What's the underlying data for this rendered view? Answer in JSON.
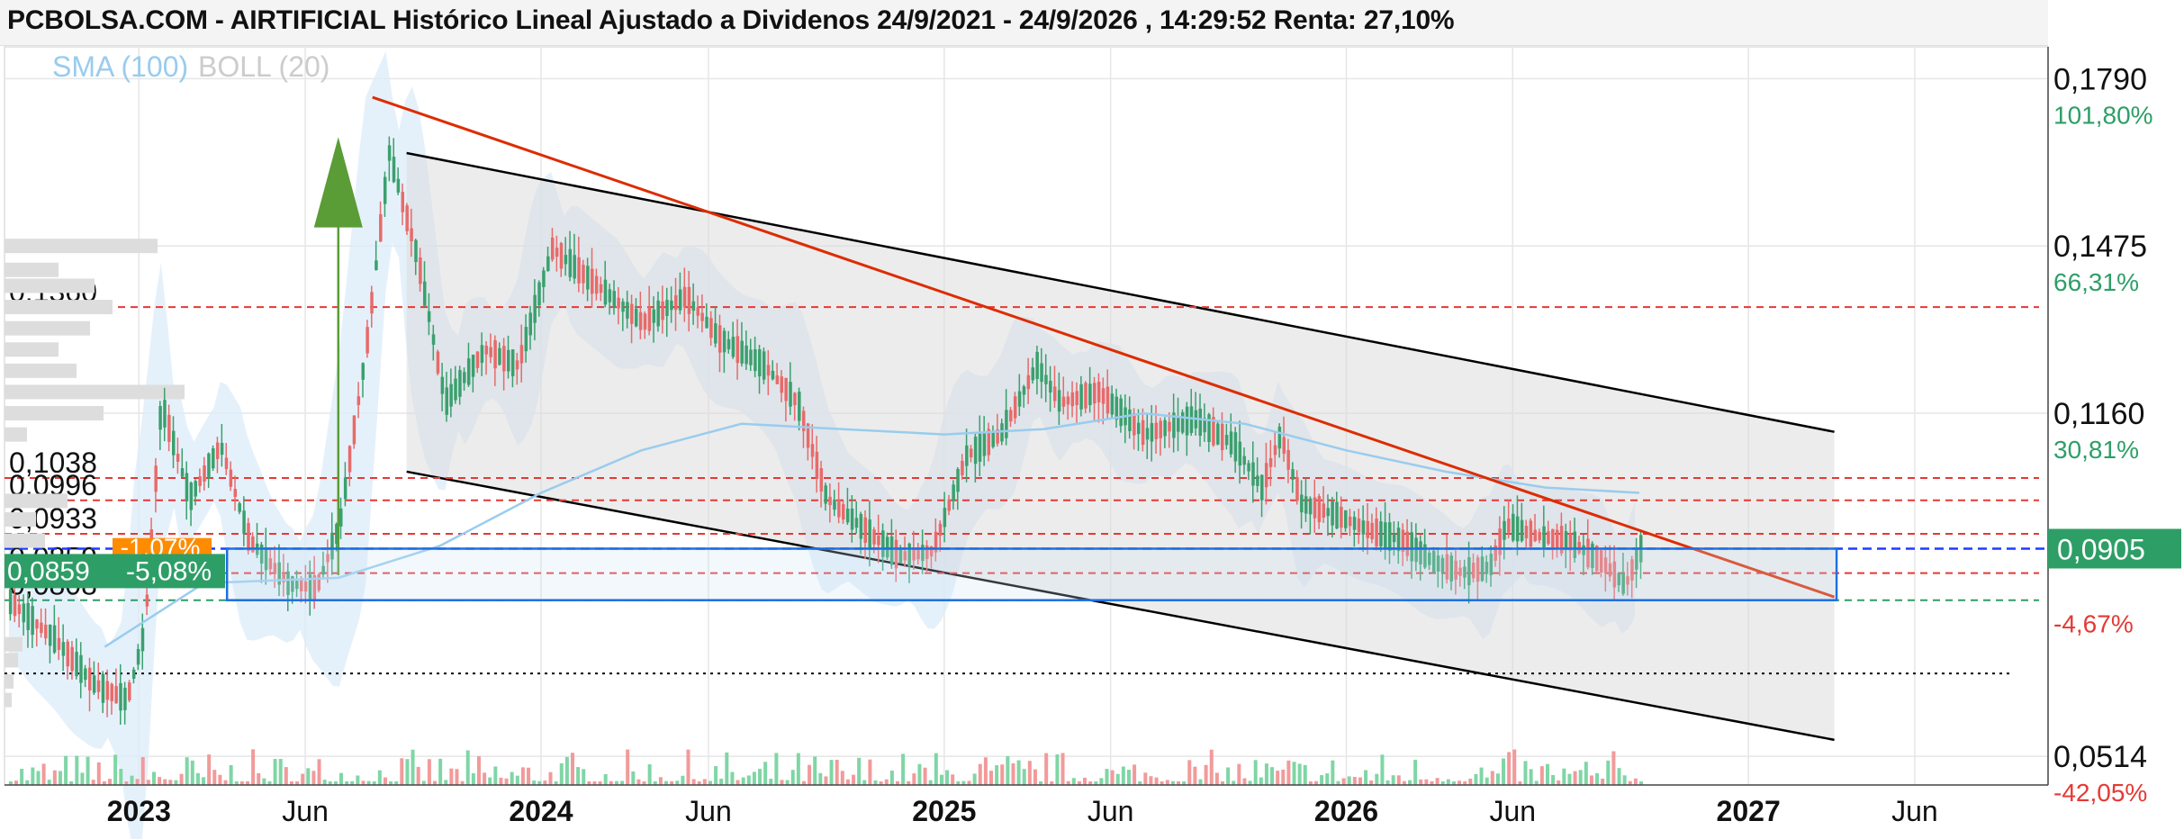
{
  "title": "PCBOLSA.COM - AIRTIFICIAL Histórico Lineal Ajustado a Dividenos 24/9/2021 - 24/9/2026 , 14:29:52 Renta: 27,10%",
  "legend": {
    "sma": "SMA (100)",
    "boll": "BOLL (20)"
  },
  "colors": {
    "up": "#3aa06e",
    "down": "#e86a6a",
    "trend": "#dd2c00",
    "channel": "#000000",
    "sma": "#99ccee",
    "bollFill": "#dcecf8",
    "support": "#e53935",
    "current": "#2e9e67"
  },
  "chart_data": {
    "type": "line",
    "price_axis": {
      "ticks": [
        {
          "value": 0.179,
          "label": "0,1790",
          "pct": "101,80%",
          "pct_color": "#2e9e67"
        },
        {
          "value": 0.1475,
          "label": "0,1475",
          "pct": "66,31%",
          "pct_color": "#2e9e67"
        },
        {
          "value": 0.116,
          "label": "0,1160",
          "pct": "30,81%",
          "pct_color": "#2e9e67"
        },
        {
          "value": 0.0514,
          "label": "0,0514",
          "pct": "-42,05%",
          "pct_color": "#e53935"
        }
      ],
      "current": {
        "value": 0.0905,
        "label": "0,0905"
      },
      "extra_pct": {
        "value": 0.0808,
        "label": "-4,67%"
      },
      "range": [
        0.046,
        0.185
      ]
    },
    "time_axis": {
      "range": [
        "2022-09-01",
        "2027-09-30"
      ],
      "labels": [
        {
          "date": "2023-01-01",
          "label": "2023",
          "bold": true
        },
        {
          "date": "2023-06-01",
          "label": "Jun",
          "bold": false
        },
        {
          "date": "2024-01-01",
          "label": "2024",
          "bold": true
        },
        {
          "date": "2024-06-01",
          "label": "Jun",
          "bold": false
        },
        {
          "date": "2025-01-01",
          "label": "2025",
          "bold": true
        },
        {
          "date": "2025-06-01",
          "label": "Jun",
          "bold": false
        },
        {
          "date": "2026-01-01",
          "label": "2026",
          "bold": true
        },
        {
          "date": "2026-06-01",
          "label": "Jun",
          "bold": false
        },
        {
          "date": "2027-01-01",
          "label": "2027",
          "bold": true
        },
        {
          "date": "2027-06-01",
          "label": "Jun",
          "bold": false
        }
      ]
    },
    "support_levels": [
      {
        "value": 0.136,
        "label": "0,1360"
      },
      {
        "value": 0.1038,
        "label": "0,1038"
      },
      {
        "value": 0.0996,
        "label": "0,0996"
      },
      {
        "value": 0.0933,
        "label": "0,0933"
      },
      {
        "value": 0.0859,
        "label": "0,0859"
      },
      {
        "value": 0.0808,
        "label": "0,0808"
      }
    ],
    "annotations": {
      "left_badge": "-5,08%",
      "left_badge_partial": "-1,07%"
    },
    "price_path": [
      {
        "date": "2022-09-05",
        "value": 0.0805
      },
      {
        "date": "2022-10-15",
        "value": 0.0735
      },
      {
        "date": "2022-11-20",
        "value": 0.065
      },
      {
        "date": "2022-12-20",
        "value": 0.062
      },
      {
        "date": "2023-01-05",
        "value": 0.075
      },
      {
        "date": "2023-01-20",
        "value": 0.118
      },
      {
        "date": "2023-02-15",
        "value": 0.1
      },
      {
        "date": "2023-03-15",
        "value": 0.11
      },
      {
        "date": "2023-04-10",
        "value": 0.092
      },
      {
        "date": "2023-05-15",
        "value": 0.084
      },
      {
        "date": "2023-06-10",
        "value": 0.083
      },
      {
        "date": "2023-07-01",
        "value": 0.095
      },
      {
        "date": "2023-07-25",
        "value": 0.128
      },
      {
        "date": "2023-08-15",
        "value": 0.165
      },
      {
        "date": "2023-09-10",
        "value": 0.145
      },
      {
        "date": "2023-10-05",
        "value": 0.118
      },
      {
        "date": "2023-11-10",
        "value": 0.128
      },
      {
        "date": "2023-12-10",
        "value": 0.125
      },
      {
        "date": "2024-01-10",
        "value": 0.147
      },
      {
        "date": "2024-02-20",
        "value": 0.14
      },
      {
        "date": "2024-04-01",
        "value": 0.133
      },
      {
        "date": "2024-05-10",
        "value": 0.138
      },
      {
        "date": "2024-06-10",
        "value": 0.13
      },
      {
        "date": "2024-07-20",
        "value": 0.125
      },
      {
        "date": "2024-08-20",
        "value": 0.118
      },
      {
        "date": "2024-09-15",
        "value": 0.1
      },
      {
        "date": "2024-10-20",
        "value": 0.094
      },
      {
        "date": "2024-11-20",
        "value": 0.089
      },
      {
        "date": "2024-12-20",
        "value": 0.09
      },
      {
        "date": "2025-01-20",
        "value": 0.108
      },
      {
        "date": "2025-02-20",
        "value": 0.112
      },
      {
        "date": "2025-03-25",
        "value": 0.125
      },
      {
        "date": "2025-04-15",
        "value": 0.118
      },
      {
        "date": "2025-05-20",
        "value": 0.12
      },
      {
        "date": "2025-07-01",
        "value": 0.112
      },
      {
        "date": "2025-08-15",
        "value": 0.115
      },
      {
        "date": "2025-09-20",
        "value": 0.11
      },
      {
        "date": "2025-10-15",
        "value": 0.102
      },
      {
        "date": "2025-11-01",
        "value": 0.112
      },
      {
        "date": "2025-11-20",
        "value": 0.099
      },
      {
        "date": "2025-12-20",
        "value": 0.097
      },
      {
        "date": "2026-01-20",
        "value": 0.094
      },
      {
        "date": "2026-02-20",
        "value": 0.092
      },
      {
        "date": "2026-03-20",
        "value": 0.088
      },
      {
        "date": "2026-04-15",
        "value": 0.086
      },
      {
        "date": "2026-05-10",
        "value": 0.087
      },
      {
        "date": "2026-05-25",
        "value": 0.095
      },
      {
        "date": "2026-06-20",
        "value": 0.093
      },
      {
        "date": "2026-07-20",
        "value": 0.092
      },
      {
        "date": "2026-08-20",
        "value": 0.088
      },
      {
        "date": "2026-09-10",
        "value": 0.0835
      },
      {
        "date": "2026-09-24",
        "value": 0.0905
      }
    ],
    "sma_path": [
      {
        "date": "2022-12-01",
        "value": 0.072
      },
      {
        "date": "2023-03-01",
        "value": 0.084
      },
      {
        "date": "2023-07-01",
        "value": 0.085
      },
      {
        "date": "2023-10-01",
        "value": 0.091
      },
      {
        "date": "2024-01-01",
        "value": 0.101
      },
      {
        "date": "2024-04-01",
        "value": 0.109
      },
      {
        "date": "2024-07-01",
        "value": 0.114
      },
      {
        "date": "2024-10-01",
        "value": 0.113
      },
      {
        "date": "2025-01-01",
        "value": 0.112
      },
      {
        "date": "2025-04-01",
        "value": 0.113
      },
      {
        "date": "2025-07-01",
        "value": 0.116
      },
      {
        "date": "2025-10-01",
        "value": 0.114
      },
      {
        "date": "2026-01-01",
        "value": 0.109
      },
      {
        "date": "2026-04-01",
        "value": 0.105
      },
      {
        "date": "2026-07-01",
        "value": 0.102
      },
      {
        "date": "2026-09-24",
        "value": 0.101
      }
    ],
    "trendline": {
      "start": {
        "date": "2023-08-01",
        "value": 0.1755
      },
      "end": {
        "date": "2027-03-20",
        "value": 0.0814
      }
    },
    "channel": {
      "upper": {
        "start": {
          "date": "2023-09-01",
          "value": 0.165
        },
        "end": {
          "date": "2027-03-20",
          "value": 0.1125
        }
      },
      "lower": {
        "start": {
          "date": "2023-09-01",
          "value": 0.105
        },
        "end": {
          "date": "2027-03-20",
          "value": 0.0545
        }
      }
    },
    "grid": true
  }
}
